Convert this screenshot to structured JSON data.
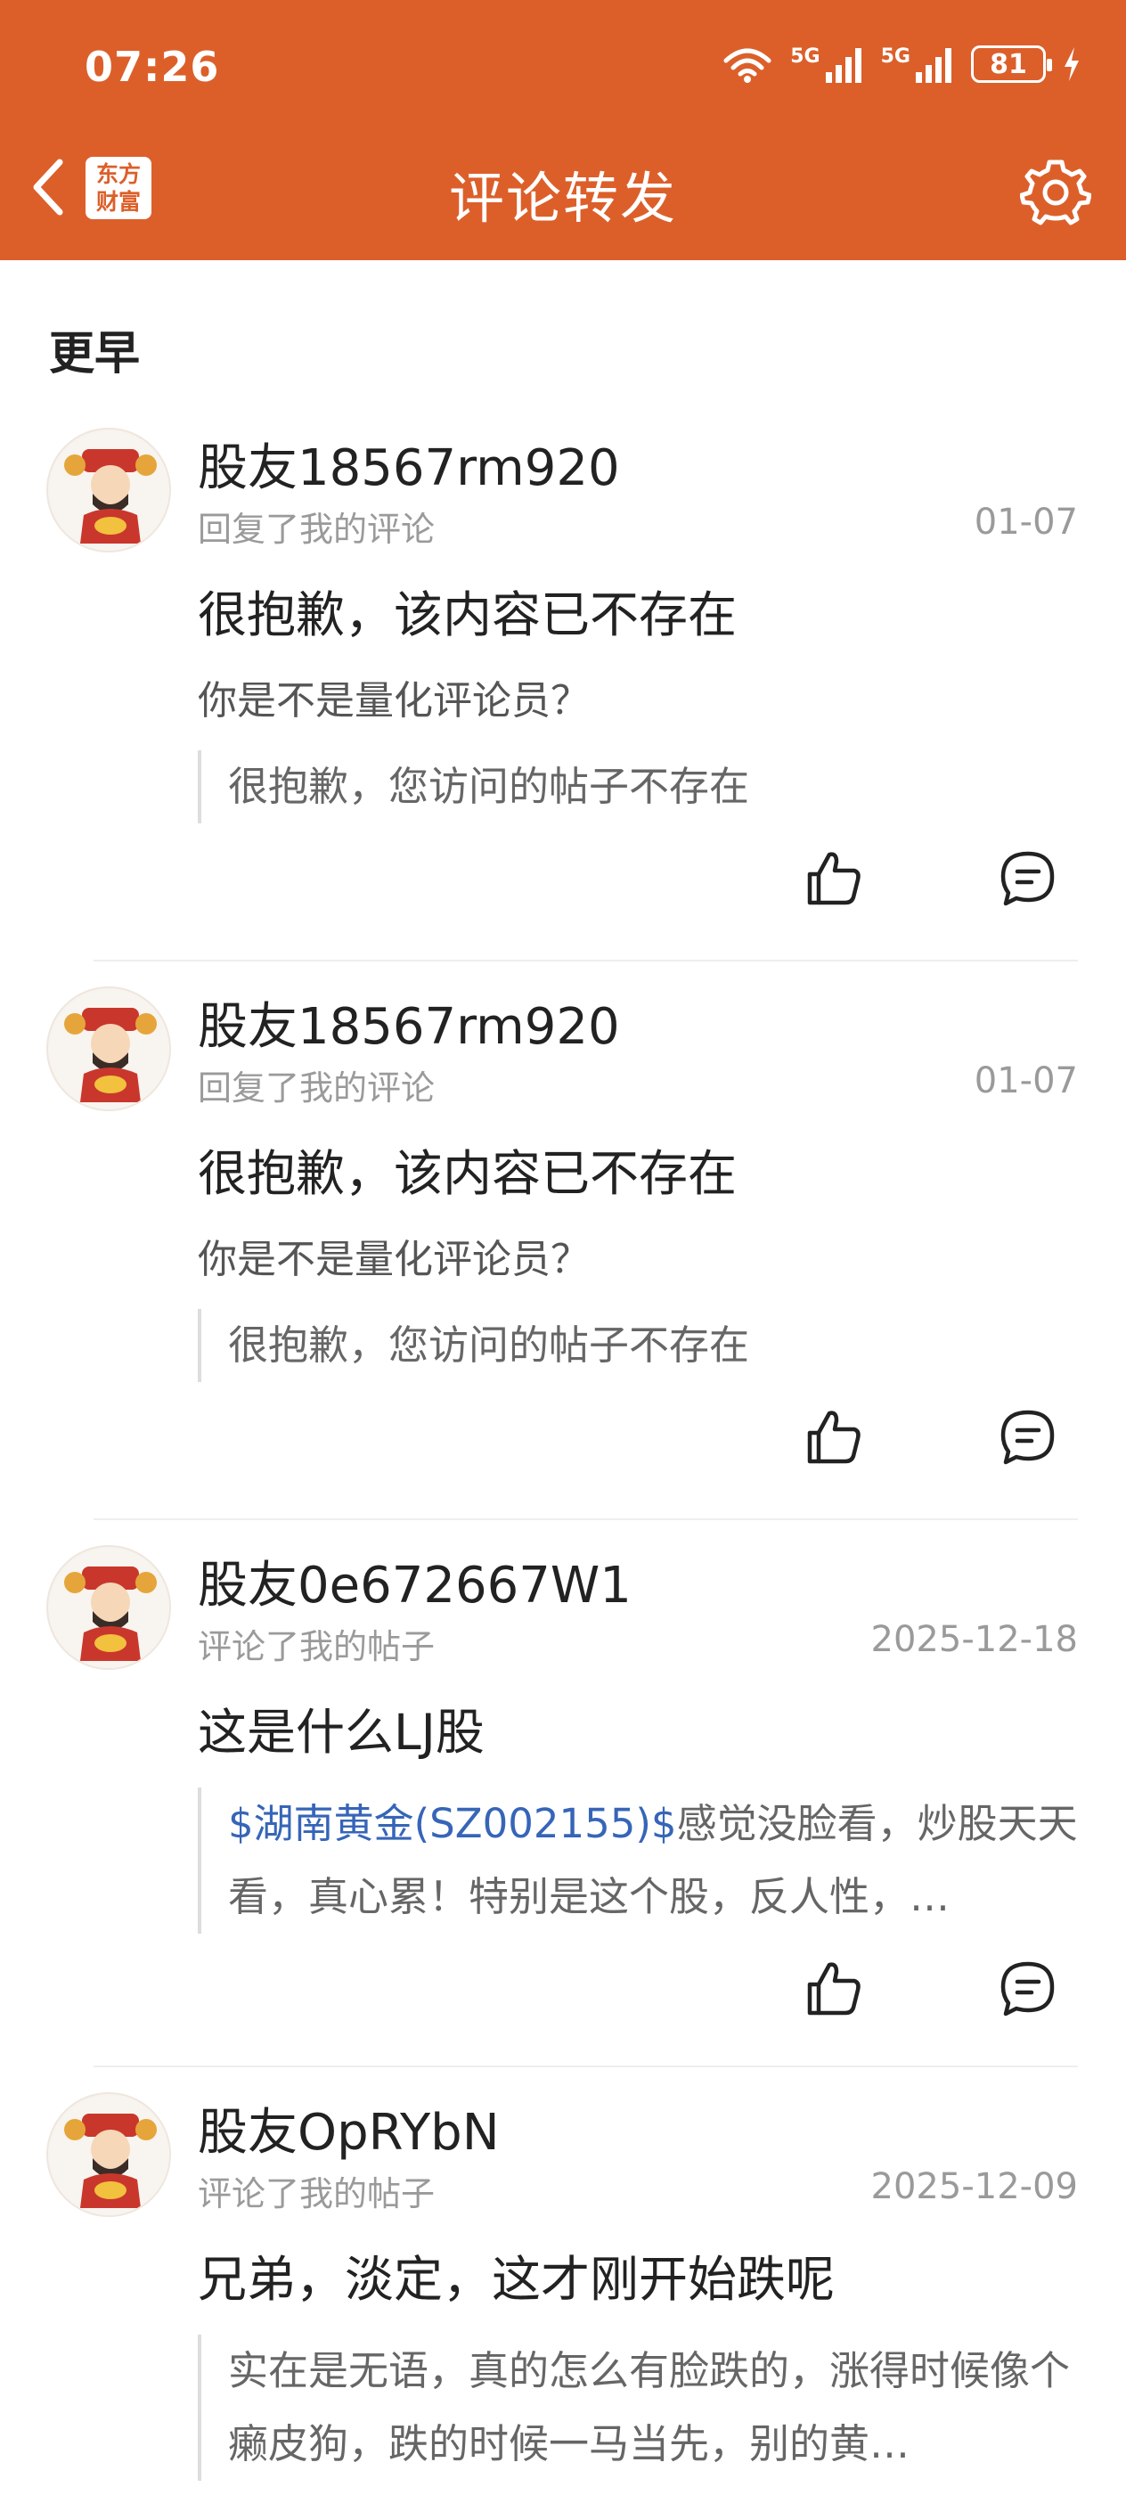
{
  "status_bar": {
    "time": "07:26",
    "network_1": "5G",
    "network_2": "5G",
    "battery": "81"
  },
  "header": {
    "logo_line1": "东方",
    "logo_line2": "财富",
    "title": "评论转发"
  },
  "section": {
    "label": "更早"
  },
  "items": [
    {
      "user": "股友18567rm920",
      "action": "回复了我的评论",
      "date": "01-07",
      "headline": "很抱歉，该内容已不存在",
      "reply": "你是不是量化评论员？",
      "quote": "很抱歉，您访问的帖子不存在"
    },
    {
      "user": "股友18567rm920",
      "action": "回复了我的评论",
      "date": "01-07",
      "headline": "很抱歉，该内容已不存在",
      "reply": "你是不是量化评论员？",
      "quote": "很抱歉，您访问的帖子不存在"
    },
    {
      "user": "股友0e672667W1",
      "action": "评论了我的帖子",
      "date": "2025-12-18",
      "headline": "这是什么LJ股",
      "quote_tag": "$湖南黄金(SZ002155)$",
      "quote": "感觉没脸看，炒股天天看，真心累！特别是这个股，反人性，…"
    },
    {
      "user": "股友OpRYbN",
      "action": "评论了我的帖子",
      "date": "2025-12-09",
      "headline": "兄弟，淡定，这才刚开始跌呢",
      "quote": "实在是无语，真的怎么有脸跌的，涨得时候像个癞皮狗，跌的时候一马当先，别的黄…"
    }
  ],
  "colors": {
    "brand": "#dc5f2a",
    "link": "#3665b8",
    "muted": "#9a9a9a"
  },
  "icons": {
    "back": "chevron-left-icon",
    "settings": "gear-icon",
    "like": "thumbs-up-icon",
    "comment": "chat-bubble-icon"
  }
}
